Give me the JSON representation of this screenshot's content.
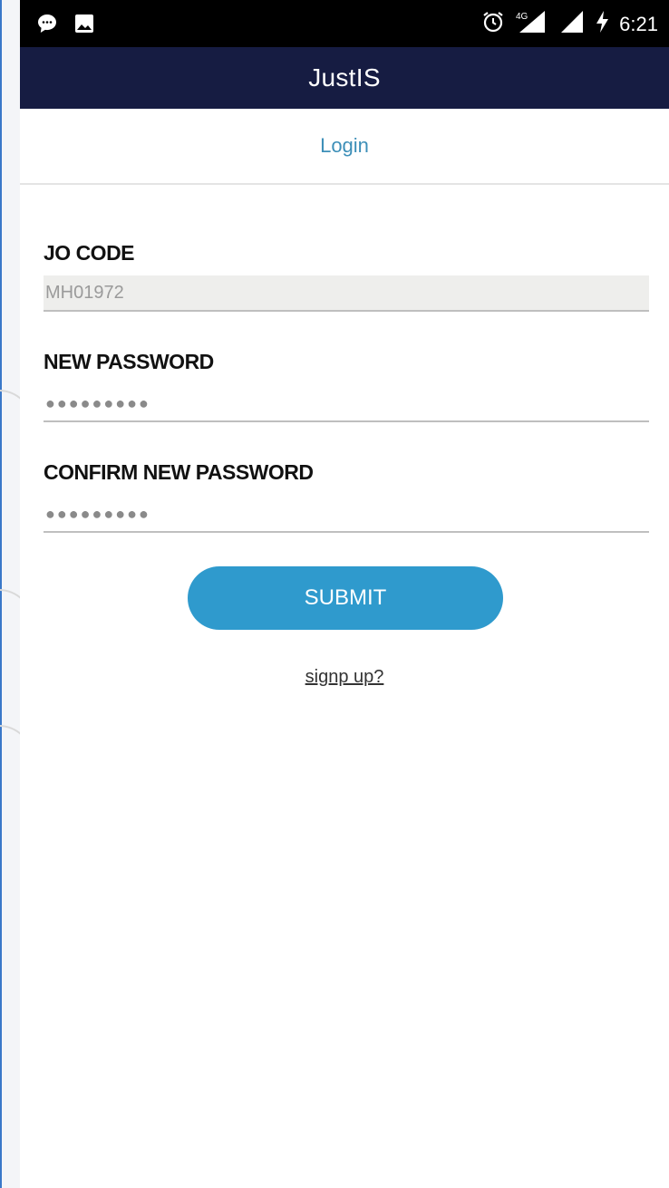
{
  "status_bar": {
    "time": "6:21",
    "network": "4G",
    "icons": [
      "chat-icon",
      "image-icon",
      "alarm-icon",
      "signal-4g-icon",
      "signal-icon",
      "charging-icon"
    ]
  },
  "app_bar": {
    "title": "JustIS"
  },
  "tab": {
    "label": "Login"
  },
  "form": {
    "jo_code_label": "JO CODE",
    "jo_code_value": "MH01972",
    "new_password_label": "NEW PASSWORD",
    "new_password_value": "●●●●●●●●●",
    "confirm_password_label": "CONFIRM NEW PASSWORD",
    "confirm_password_value": "●●●●●●●●●",
    "submit_label": "SUBMIT",
    "signup_label": "signp up?"
  },
  "colors": {
    "app_bar": "#161c42",
    "accent": "#2f9acd",
    "tab_text": "#3d8fb8"
  }
}
